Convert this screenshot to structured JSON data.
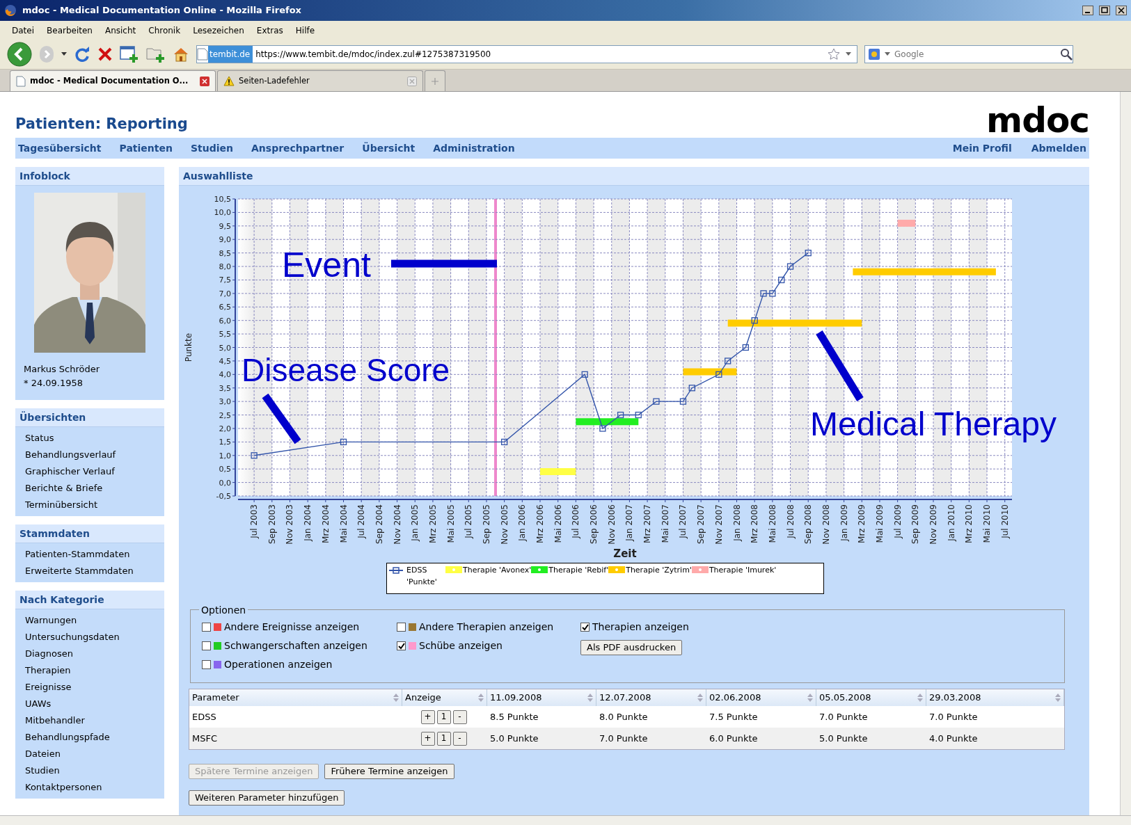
{
  "browser": {
    "title": "mdoc - Medical Documentation Online - Mozilla Firefox",
    "menu": [
      "Datei",
      "Bearbeiten",
      "Ansicht",
      "Chronik",
      "Lesezeichen",
      "Extras",
      "Hilfe"
    ],
    "identity": "tembit.de",
    "url": "https://www.tembit.de/mdoc/index.zul#1275387319500",
    "search_placeholder": "Google",
    "tabs": [
      {
        "label": "mdoc - Medical Documentation O...",
        "selected": true,
        "kind": "page"
      },
      {
        "label": "Seiten-Ladefehler",
        "selected": false,
        "kind": "warning"
      }
    ]
  },
  "page_title": "Patienten: Reporting",
  "logo": "mdoc",
  "nav": {
    "left": [
      "Tagesübersicht",
      "Patienten",
      "Studien",
      "Ansprechpartner",
      "Übersicht",
      "Administration"
    ],
    "right": [
      "Mein Profil",
      "Abmelden"
    ]
  },
  "sidebar": {
    "infoblock": {
      "title": "Infoblock",
      "name": "Markus Schröder",
      "birth": "* 24.09.1958"
    },
    "sections": [
      {
        "title": "Übersichten",
        "items": [
          "Status",
          "Behandlungsverlauf",
          "Graphischer Verlauf",
          "Berichte & Briefe",
          "Terminübersicht"
        ]
      },
      {
        "title": "Stammdaten",
        "items": [
          "Patienten-Stammdaten",
          "Erweiterte Stammdaten"
        ]
      },
      {
        "title": "Nach Kategorie",
        "items": [
          "Warnungen",
          "Untersuchungsdaten",
          "Diagnosen",
          "Therapien",
          "Ereignisse",
          "UAWs",
          "Mitbehandler",
          "Behandlungspfade",
          "Dateien",
          "Studien",
          "Kontaktpersonen"
        ]
      }
    ]
  },
  "main": {
    "title": "Auswahlliste",
    "chart_data": {
      "type": "line",
      "xlabel": "Zeit",
      "ylabel": "Punkte",
      "categories": [
        "Jul 2003",
        null,
        "Sep 2003",
        null,
        "Nov 2003",
        null,
        "Jan 2004",
        null,
        "Mrz 2004",
        null,
        "Mai 2004",
        null,
        "Jul 2004",
        null,
        "Sep 2004",
        null,
        "Nov 2004",
        null,
        "Jan 2005",
        null,
        "Mrz 2005",
        null,
        "Mai 2005",
        null,
        "Jul 2005",
        null,
        "Sep 2005",
        null,
        "Nov 2005",
        null,
        "Jan 2006",
        null,
        "Mrz 2006",
        null,
        "Mai 2006",
        null,
        "Jul 2006",
        null,
        "Sep 2006",
        null,
        "Nov 2006",
        null,
        "Jan 2007",
        null,
        "Mrz 2007",
        null,
        "Mai 2007",
        null,
        "Jul 2007",
        null,
        "Sep 2007",
        null,
        "Nov 2007",
        null,
        "Jan 2008",
        null,
        "Mrz 2008",
        null,
        "Mai 2008",
        null,
        "Jul 2008",
        null,
        "Sep 2008",
        null,
        "Nov 2008",
        null,
        "Jan 2009",
        null,
        "Mrz 2009",
        null,
        "Mai 2009",
        null,
        "Jul 2009",
        null,
        "Sep 2009",
        null,
        "Nov 2009",
        null,
        "Jan 2010",
        null,
        "Mrz 2010",
        null,
        "Mai 2010",
        null,
        "Jul 2010"
      ],
      "series": [
        {
          "name": "EDSS 'Punkte'",
          "color": "#3355aa",
          "marker": "square",
          "values": [
            1,
            null,
            null,
            null,
            null,
            null,
            null,
            null,
            null,
            null,
            1.5,
            null,
            null,
            null,
            null,
            null,
            null,
            null,
            null,
            null,
            null,
            null,
            null,
            null,
            null,
            null,
            null,
            null,
            1.5,
            null,
            null,
            null,
            null,
            null,
            null,
            null,
            null,
            4,
            null,
            2,
            null,
            2.5,
            null,
            2.5,
            null,
            3,
            null,
            null,
            3,
            3.5,
            null,
            null,
            4,
            4.5,
            null,
            5,
            6,
            7,
            7,
            7.5,
            8,
            null,
            8.5,
            null,
            null,
            null,
            null,
            null,
            null,
            null,
            null,
            null,
            null,
            null,
            null,
            null,
            null,
            null,
            null,
            null,
            null,
            null,
            null,
            null,
            null
          ]
        },
        {
          "name": "Therapie 'Avonex'",
          "color": "#ffff44",
          "values": [
            null,
            null,
            null,
            null,
            null,
            null,
            null,
            null,
            null,
            null,
            null,
            null,
            null,
            null,
            null,
            null,
            null,
            null,
            null,
            null,
            null,
            null,
            null,
            null,
            null,
            null,
            null,
            null,
            null,
            null,
            null,
            null,
            0.4,
            null,
            null,
            null,
            0.4,
            null,
            null,
            null,
            null,
            null,
            null,
            null,
            null,
            null,
            null,
            null,
            null,
            null,
            null,
            null,
            null,
            null,
            null,
            null,
            null,
            null,
            null,
            null,
            null,
            null,
            null,
            null,
            null,
            null,
            null,
            null,
            null,
            null,
            null,
            null,
            null,
            null,
            null,
            null,
            null,
            null,
            null,
            null,
            null,
            null,
            null,
            null,
            null
          ]
        },
        {
          "name": "Therapie 'Rebif'",
          "color": "#22ee22",
          "values": [
            null,
            null,
            null,
            null,
            null,
            null,
            null,
            null,
            null,
            null,
            null,
            null,
            null,
            null,
            null,
            null,
            null,
            null,
            null,
            null,
            null,
            null,
            null,
            null,
            null,
            null,
            null,
            null,
            null,
            null,
            null,
            null,
            null,
            null,
            null,
            null,
            2.25,
            null,
            null,
            null,
            null,
            null,
            null,
            2.25,
            null,
            null,
            null,
            null,
            null,
            null,
            null,
            null,
            null,
            null,
            null,
            null,
            null,
            null,
            null,
            null,
            null,
            null,
            null,
            null,
            null,
            null,
            null,
            null,
            null,
            null,
            null,
            null,
            null,
            null,
            null,
            null,
            null,
            null,
            null,
            null,
            null,
            null,
            null,
            null,
            null
          ]
        },
        {
          "name": "Therapie 'Zytrim'",
          "color": "#ffcc00",
          "values": [
            null,
            null,
            null,
            null,
            null,
            null,
            null,
            null,
            null,
            null,
            null,
            null,
            null,
            null,
            null,
            null,
            null,
            null,
            null,
            null,
            null,
            null,
            null,
            null,
            null,
            null,
            null,
            null,
            null,
            null,
            null,
            null,
            null,
            null,
            null,
            null,
            null,
            null,
            null,
            null,
            null,
            null,
            null,
            null,
            null,
            null,
            null,
            null,
            4.1,
            null,
            null,
            null,
            null,
            null,
            4.1,
            null,
            null,
            null,
            null,
            null,
            null,
            null,
            null,
            null,
            null,
            null,
            null,
            null,
            null,
            null,
            null,
            null,
            null,
            null,
            null,
            null,
            null,
            null,
            null,
            null,
            null,
            null,
            null,
            null,
            null
          ]
        },
        {
          "color": "#ffcc00",
          "values": [
            null,
            null,
            null,
            null,
            null,
            null,
            null,
            null,
            null,
            null,
            null,
            null,
            null,
            null,
            null,
            null,
            null,
            null,
            null,
            null,
            null,
            null,
            null,
            null,
            null,
            null,
            null,
            null,
            null,
            null,
            null,
            null,
            null,
            null,
            null,
            null,
            null,
            null,
            null,
            null,
            null,
            null,
            null,
            null,
            null,
            null,
            null,
            null,
            null,
            null,
            null,
            null,
            null,
            5.9,
            null,
            null,
            null,
            null,
            null,
            null,
            null,
            null,
            null,
            null,
            null,
            null,
            null,
            null,
            5.9,
            null,
            null,
            null,
            null,
            null,
            null,
            null,
            null,
            null,
            null,
            null,
            null,
            null,
            null,
            null,
            null
          ]
        },
        {
          "color": "#ffcc00",
          "values": [
            null,
            null,
            null,
            null,
            null,
            null,
            null,
            null,
            null,
            null,
            null,
            null,
            null,
            null,
            null,
            null,
            null,
            null,
            null,
            null,
            null,
            null,
            null,
            null,
            null,
            null,
            null,
            null,
            null,
            null,
            null,
            null,
            null,
            null,
            null,
            null,
            null,
            null,
            null,
            null,
            null,
            null,
            null,
            null,
            null,
            null,
            null,
            null,
            null,
            null,
            null,
            null,
            null,
            null,
            null,
            null,
            null,
            null,
            null,
            null,
            null,
            null,
            null,
            null,
            null,
            null,
            null,
            7.8,
            null,
            null,
            null,
            null,
            null,
            null,
            null,
            null,
            null,
            null,
            null,
            null,
            null,
            null,
            null,
            7.8,
            null
          ]
        },
        {
          "name": "Therapie 'Imurek'",
          "color": "#ffaaaa",
          "values": [
            null,
            null,
            null,
            null,
            null,
            null,
            null,
            null,
            null,
            null,
            null,
            null,
            null,
            null,
            null,
            null,
            null,
            null,
            null,
            null,
            null,
            null,
            null,
            null,
            null,
            null,
            null,
            null,
            null,
            null,
            null,
            null,
            null,
            null,
            null,
            null,
            null,
            null,
            null,
            null,
            null,
            null,
            null,
            null,
            null,
            null,
            null,
            null,
            null,
            null,
            null,
            null,
            null,
            null,
            null,
            null,
            null,
            null,
            null,
            null,
            null,
            null,
            null,
            null,
            null,
            null,
            null,
            null,
            null,
            null,
            null,
            null,
            9.6,
            null,
            9.6,
            null,
            null,
            null,
            null,
            null,
            null,
            null,
            null,
            null,
            null
          ]
        }
      ],
      "grid": true,
      "ylim": [
        -0.5,
        10.5
      ],
      "yticks": [
        {
          "value": -0.5,
          "label": "-0,5"
        },
        {
          "value": 0,
          "label": "0,0"
        },
        {
          "value": 0.5,
          "label": "0,5"
        },
        {
          "value": 1,
          "label": "1,0"
        },
        {
          "value": 1.5,
          "label": "1,5"
        },
        {
          "value": 2,
          "label": "2,0"
        },
        {
          "value": 2.5,
          "label": "2,5"
        },
        {
          "value": 3,
          "label": "3,0"
        },
        {
          "value": 3.5,
          "label": "3,5"
        },
        {
          "value": 4,
          "label": "4,0"
        },
        {
          "value": 4.5,
          "label": "4,5"
        },
        {
          "value": 5,
          "label": "5,0"
        },
        {
          "value": 5.5,
          "label": "5,5"
        },
        {
          "value": 6,
          "label": "6,0"
        },
        {
          "value": 6.5,
          "label": "6,5"
        },
        {
          "value": 7,
          "label": "7,0"
        },
        {
          "value": 7.5,
          "label": "7,5"
        },
        {
          "value": 8,
          "label": "8,0"
        },
        {
          "value": 8.5,
          "label": "8,5"
        },
        {
          "value": 9,
          "label": "9,0"
        },
        {
          "value": 9.5,
          "label": "9,5"
        },
        {
          "value": 10,
          "label": "10,0"
        },
        {
          "value": 10.5,
          "label": "10,5"
        }
      ]
    },
    "callouts": [
      {
        "text": "Event"
      },
      {
        "text": "Disease Score"
      },
      {
        "text": "Medical Therapy"
      }
    ],
    "options": {
      "title": "Optionen",
      "columns": [
        [
          {
            "kind": "checkbox",
            "label": "Andere Ereignisse anzeigen",
            "checked": false,
            "color": "#ee4444"
          },
          {
            "kind": "checkbox",
            "label": "Schwangerschaften anzeigen",
            "checked": false,
            "color": "#22cc22"
          },
          {
            "kind": "checkbox",
            "label": "Operationen anzeigen",
            "checked": false,
            "color": "#8866ee"
          }
        ],
        [
          {
            "kind": "checkbox",
            "label": "Andere Therapien anzeigen",
            "checked": false,
            "color": "#997733"
          },
          {
            "kind": "checkbox",
            "label": "Schübe anzeigen",
            "checked": true,
            "color": "#ff99cc"
          }
        ],
        [
          {
            "kind": "checkbox",
            "label": "Therapien anzeigen",
            "checked": true
          },
          {
            "kind": "button",
            "label": "Als PDF ausdrucken"
          }
        ]
      ]
    },
    "table": {
      "columns": [
        "Parameter",
        "Anzeige",
        "11.09.2008",
        "12.07.2008",
        "02.06.2008",
        "05.05.2008",
        "29.03.2008"
      ],
      "rows": [
        {
          "parameter": "EDSS",
          "controls": [
            "+",
            "1",
            "-"
          ],
          "values": [
            "8.5 Punkte",
            "8.0 Punkte",
            "7.5 Punkte",
            "7.0 Punkte",
            "7.0 Punkte"
          ]
        },
        {
          "parameter": "MSFC",
          "controls": [
            "+",
            "1",
            "-"
          ],
          "values": [
            "5.0 Punkte",
            "7.0 Punkte",
            "6.0 Punkte",
            "5.0 Punkte",
            "4.0 Punkte"
          ]
        }
      ]
    },
    "paging": [
      {
        "label": "Spätere Termine anzeigen",
        "disabled": true
      },
      {
        "label": "Frühere Termine anzeigen",
        "disabled": false
      }
    ],
    "add_button": "Weiteren Parameter hinzufügen"
  }
}
